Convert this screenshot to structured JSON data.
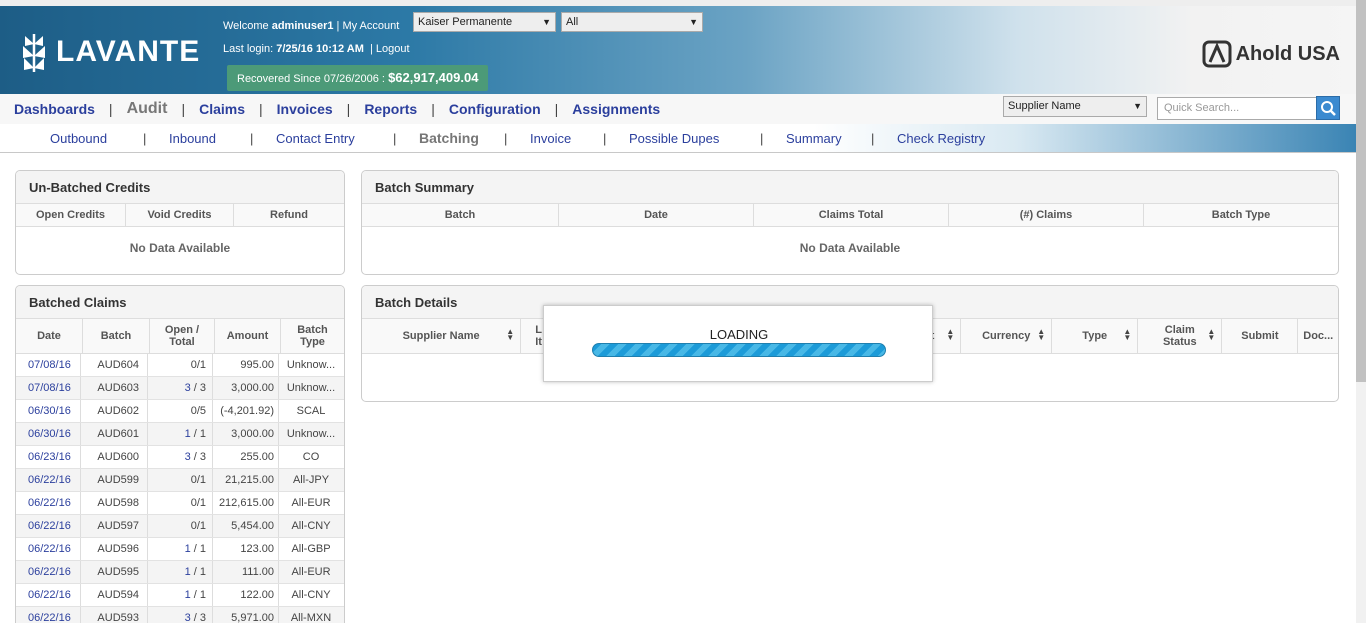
{
  "header": {
    "logo_text": "LAVANTE",
    "welcome_prefix": "Welcome",
    "username": "adminuser1",
    "my_account": "| My Account",
    "last_login_label": "Last login:",
    "last_login_value": "7/25/16 10:12 AM",
    "logout": "|  Logout",
    "recovered_label": "Recovered Since 07/26/2006 :",
    "recovered_value": "$62,917,409.04",
    "client_select": "Kaiser Permanente",
    "scope_select": "All",
    "brand_right": "Ahold USA"
  },
  "main_nav": {
    "items": [
      "Dashboards",
      "Audit",
      "Claims",
      "Invoices",
      "Reports",
      "Configuration",
      "Assignments"
    ],
    "active": "Audit",
    "supplier_select": "Supplier Name",
    "search_placeholder": "Quick Search..."
  },
  "sub_nav": {
    "items": [
      "Outbound",
      "Inbound",
      "Contact Entry",
      "Batching",
      "Invoice",
      "Possible Dupes",
      "Summary",
      "Check Registry"
    ],
    "active": "Batching"
  },
  "unbatched_credits": {
    "title": "Un-Batched Credits",
    "columns": [
      "Open Credits",
      "Void Credits",
      "Refund"
    ],
    "empty_text": "No Data Available"
  },
  "batch_summary": {
    "title": "Batch Summary",
    "columns": [
      "Batch",
      "Date",
      "Claims Total",
      "(#) Claims",
      "Batch Type"
    ],
    "empty_text": "No Data Available"
  },
  "batched_claims": {
    "title": "Batched Claims",
    "columns": {
      "date": "Date",
      "batch": "Batch",
      "open_total_1": "Open /",
      "open_total_2": "Total",
      "amount": "Amount",
      "batch_type_1": "Batch",
      "batch_type_2": "Type"
    },
    "rows": [
      {
        "date": "07/08/16",
        "batch": "AUD604",
        "open": "0",
        "total": "1",
        "open_link": false,
        "amount": "995.00",
        "type": "Unknow..."
      },
      {
        "date": "07/08/16",
        "batch": "AUD603",
        "open": "3",
        "total": "3",
        "open_link": true,
        "amount": "3,000.00",
        "type": "Unknow..."
      },
      {
        "date": "06/30/16",
        "batch": "AUD602",
        "open": "0",
        "total": "5",
        "open_link": false,
        "amount": "(-4,201.92)",
        "type": "SCAL"
      },
      {
        "date": "06/30/16",
        "batch": "AUD601",
        "open": "1",
        "total": "1",
        "open_link": true,
        "amount": "3,000.00",
        "type": "Unknow..."
      },
      {
        "date": "06/23/16",
        "batch": "AUD600",
        "open": "3",
        "total": "3",
        "open_link": true,
        "amount": "255.00",
        "type": "CO"
      },
      {
        "date": "06/22/16",
        "batch": "AUD599",
        "open": "0",
        "total": "1",
        "open_link": false,
        "amount": "21,215.00",
        "type": "All-JPY"
      },
      {
        "date": "06/22/16",
        "batch": "AUD598",
        "open": "0",
        "total": "1",
        "open_link": false,
        "amount": "212,615.00",
        "type": "All-EUR"
      },
      {
        "date": "06/22/16",
        "batch": "AUD597",
        "open": "0",
        "total": "1",
        "open_link": false,
        "amount": "5,454.00",
        "type": "All-CNY"
      },
      {
        "date": "06/22/16",
        "batch": "AUD596",
        "open": "1",
        "total": "1",
        "open_link": true,
        "amount": "123.00",
        "type": "All-GBP"
      },
      {
        "date": "06/22/16",
        "batch": "AUD595",
        "open": "1",
        "total": "1",
        "open_link": true,
        "amount": "111.00",
        "type": "All-EUR"
      },
      {
        "date": "06/22/16",
        "batch": "AUD594",
        "open": "1",
        "total": "1",
        "open_link": true,
        "amount": "122.00",
        "type": "All-CNY"
      },
      {
        "date": "06/22/16",
        "batch": "AUD593",
        "open": "3",
        "total": "3",
        "open_link": true,
        "amount": "5,971.00",
        "type": "All-MXN"
      }
    ]
  },
  "batch_details": {
    "title": "Batch Details",
    "columns": {
      "supplier_name": "Supplier Name",
      "col2_partial": "L\nIt",
      "col3_partial": "t",
      "currency": "Currency",
      "type": "Type",
      "claim_status_1": "Claim",
      "claim_status_2": "Status",
      "submit": "Submit",
      "doc": "Doc..."
    }
  },
  "loading": {
    "label": "LOADING",
    "progress": 1.0
  },
  "colors": {
    "link": "#2b3f9d",
    "header_blue": "#1d5d86",
    "recovered_green": "#4c9a78",
    "progress_blue": "#1c9bd8"
  }
}
